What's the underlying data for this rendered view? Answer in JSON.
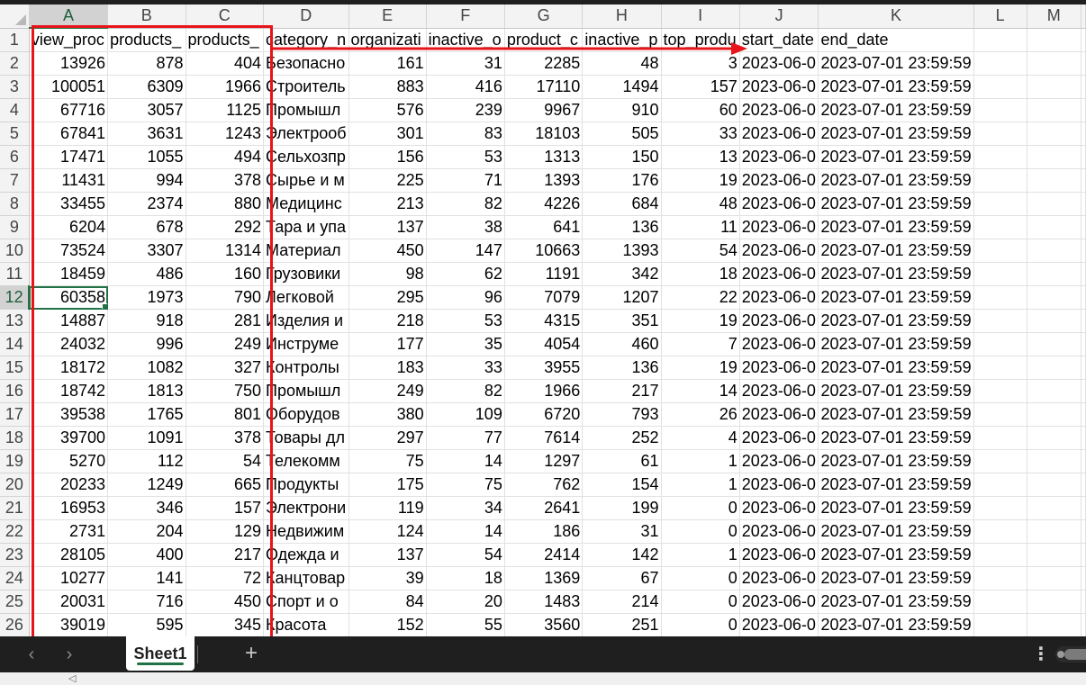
{
  "sheet": {
    "columns": [
      "A",
      "B",
      "C",
      "D",
      "E",
      "F",
      "G",
      "H",
      "I",
      "J",
      "K",
      "L",
      "M"
    ],
    "active_cell": {
      "row": 12,
      "col": "A"
    },
    "rows": [
      {
        "n": "1",
        "cells": [
          "view_proc",
          "products_",
          "products_",
          "category_n",
          "organizati",
          "inactive_o",
          "product_c",
          "inactive_p",
          "top_produ",
          "start_date",
          "end_date",
          "",
          ""
        ]
      },
      {
        "n": "2",
        "cells": [
          "13926",
          "878",
          "404",
          "Безопасно",
          "161",
          "31",
          "2285",
          "48",
          "3",
          "2023-06-0",
          "2023-07-01 23:59:59",
          "",
          ""
        ]
      },
      {
        "n": "3",
        "cells": [
          "100051",
          "6309",
          "1966",
          "Строитель",
          "883",
          "416",
          "17110",
          "1494",
          "157",
          "2023-06-0",
          "2023-07-01 23:59:59",
          "",
          ""
        ]
      },
      {
        "n": "4",
        "cells": [
          "67716",
          "3057",
          "1125",
          "Промышл",
          "576",
          "239",
          "9967",
          "910",
          "60",
          "2023-06-0",
          "2023-07-01 23:59:59",
          "",
          ""
        ]
      },
      {
        "n": "5",
        "cells": [
          "67841",
          "3631",
          "1243",
          "Электрооб",
          "301",
          "83",
          "18103",
          "505",
          "33",
          "2023-06-0",
          "2023-07-01 23:59:59",
          "",
          ""
        ]
      },
      {
        "n": "6",
        "cells": [
          "17471",
          "1055",
          "494",
          "Сельхозпр",
          "156",
          "53",
          "1313",
          "150",
          "13",
          "2023-06-0",
          "2023-07-01 23:59:59",
          "",
          ""
        ]
      },
      {
        "n": "7",
        "cells": [
          "11431",
          "994",
          "378",
          "Сырье и м",
          "225",
          "71",
          "1393",
          "176",
          "19",
          "2023-06-0",
          "2023-07-01 23:59:59",
          "",
          ""
        ]
      },
      {
        "n": "8",
        "cells": [
          "33455",
          "2374",
          "880",
          "Медицинс",
          "213",
          "82",
          "4226",
          "684",
          "48",
          "2023-06-0",
          "2023-07-01 23:59:59",
          "",
          ""
        ]
      },
      {
        "n": "9",
        "cells": [
          "6204",
          "678",
          "292",
          "Тара и упа",
          "137",
          "38",
          "641",
          "136",
          "11",
          "2023-06-0",
          "2023-07-01 23:59:59",
          "",
          ""
        ]
      },
      {
        "n": "10",
        "cells": [
          "73524",
          "3307",
          "1314",
          "Материал",
          "450",
          "147",
          "10663",
          "1393",
          "54",
          "2023-06-0",
          "2023-07-01 23:59:59",
          "",
          ""
        ]
      },
      {
        "n": "11",
        "cells": [
          "18459",
          "486",
          "160",
          "Грузовики",
          "98",
          "62",
          "1191",
          "342",
          "18",
          "2023-06-0",
          "2023-07-01 23:59:59",
          "",
          ""
        ]
      },
      {
        "n": "12",
        "cells": [
          "60358",
          "1973",
          "790",
          "Легковой",
          "295",
          "96",
          "7079",
          "1207",
          "22",
          "2023-06-0",
          "2023-07-01 23:59:59",
          "",
          ""
        ]
      },
      {
        "n": "13",
        "cells": [
          "14887",
          "918",
          "281",
          "Изделия и",
          "218",
          "53",
          "4315",
          "351",
          "19",
          "2023-06-0",
          "2023-07-01 23:59:59",
          "",
          ""
        ]
      },
      {
        "n": "14",
        "cells": [
          "24032",
          "996",
          "249",
          "Инструме",
          "177",
          "35",
          "4054",
          "460",
          "7",
          "2023-06-0",
          "2023-07-01 23:59:59",
          "",
          ""
        ]
      },
      {
        "n": "15",
        "cells": [
          "18172",
          "1082",
          "327",
          "Контролы",
          "183",
          "33",
          "3955",
          "136",
          "19",
          "2023-06-0",
          "2023-07-01 23:59:59",
          "",
          ""
        ]
      },
      {
        "n": "16",
        "cells": [
          "18742",
          "1813",
          "750",
          "Промышл",
          "249",
          "82",
          "1966",
          "217",
          "14",
          "2023-06-0",
          "2023-07-01 23:59:59",
          "",
          ""
        ]
      },
      {
        "n": "17",
        "cells": [
          "39538",
          "1765",
          "801",
          "Оборудов",
          "380",
          "109",
          "6720",
          "793",
          "26",
          "2023-06-0",
          "2023-07-01 23:59:59",
          "",
          ""
        ]
      },
      {
        "n": "18",
        "cells": [
          "39700",
          "1091",
          "378",
          "Товары дл",
          "297",
          "77",
          "7614",
          "252",
          "4",
          "2023-06-0",
          "2023-07-01 23:59:59",
          "",
          ""
        ]
      },
      {
        "n": "19",
        "cells": [
          "5270",
          "112",
          "54",
          "Телекомм",
          "75",
          "14",
          "1297",
          "61",
          "1",
          "2023-06-0",
          "2023-07-01 23:59:59",
          "",
          ""
        ]
      },
      {
        "n": "20",
        "cells": [
          "20233",
          "1249",
          "665",
          "Продукты",
          "175",
          "75",
          "762",
          "154",
          "1",
          "2023-06-0",
          "2023-07-01 23:59:59",
          "",
          ""
        ]
      },
      {
        "n": "21",
        "cells": [
          "16953",
          "346",
          "157",
          "Электрони",
          "119",
          "34",
          "2641",
          "199",
          "0",
          "2023-06-0",
          "2023-07-01 23:59:59",
          "",
          ""
        ]
      },
      {
        "n": "22",
        "cells": [
          "2731",
          "204",
          "129",
          "Недвижим",
          "124",
          "14",
          "186",
          "31",
          "0",
          "2023-06-0",
          "2023-07-01 23:59:59",
          "",
          ""
        ]
      },
      {
        "n": "23",
        "cells": [
          "28105",
          "400",
          "217",
          "Одежда и",
          "137",
          "54",
          "2414",
          "142",
          "1",
          "2023-06-0",
          "2023-07-01 23:59:59",
          "",
          ""
        ]
      },
      {
        "n": "24",
        "cells": [
          "10277",
          "141",
          "72",
          "Канцтовар",
          "39",
          "18",
          "1369",
          "67",
          "0",
          "2023-06-0",
          "2023-07-01 23:59:59",
          "",
          ""
        ]
      },
      {
        "n": "25",
        "cells": [
          "20031",
          "716",
          "450",
          "Спорт и о",
          "84",
          "20",
          "1483",
          "214",
          "0",
          "2023-06-0",
          "2023-07-01 23:59:59",
          "",
          ""
        ]
      },
      {
        "n": "26",
        "cells": [
          "39019",
          "595",
          "345",
          "Красота",
          "152",
          "55",
          "3560",
          "251",
          "0",
          "2023-06-0",
          "2023-07-01 23:59:59",
          "",
          ""
        ]
      }
    ]
  },
  "tabs": {
    "prev_icon": "‹",
    "next_icon": "›",
    "sheet_name": "Sheet1",
    "add_icon": "+",
    "more_icon": "⋮"
  },
  "colors": {
    "highlight": "#e8141b",
    "accent": "#217346"
  }
}
